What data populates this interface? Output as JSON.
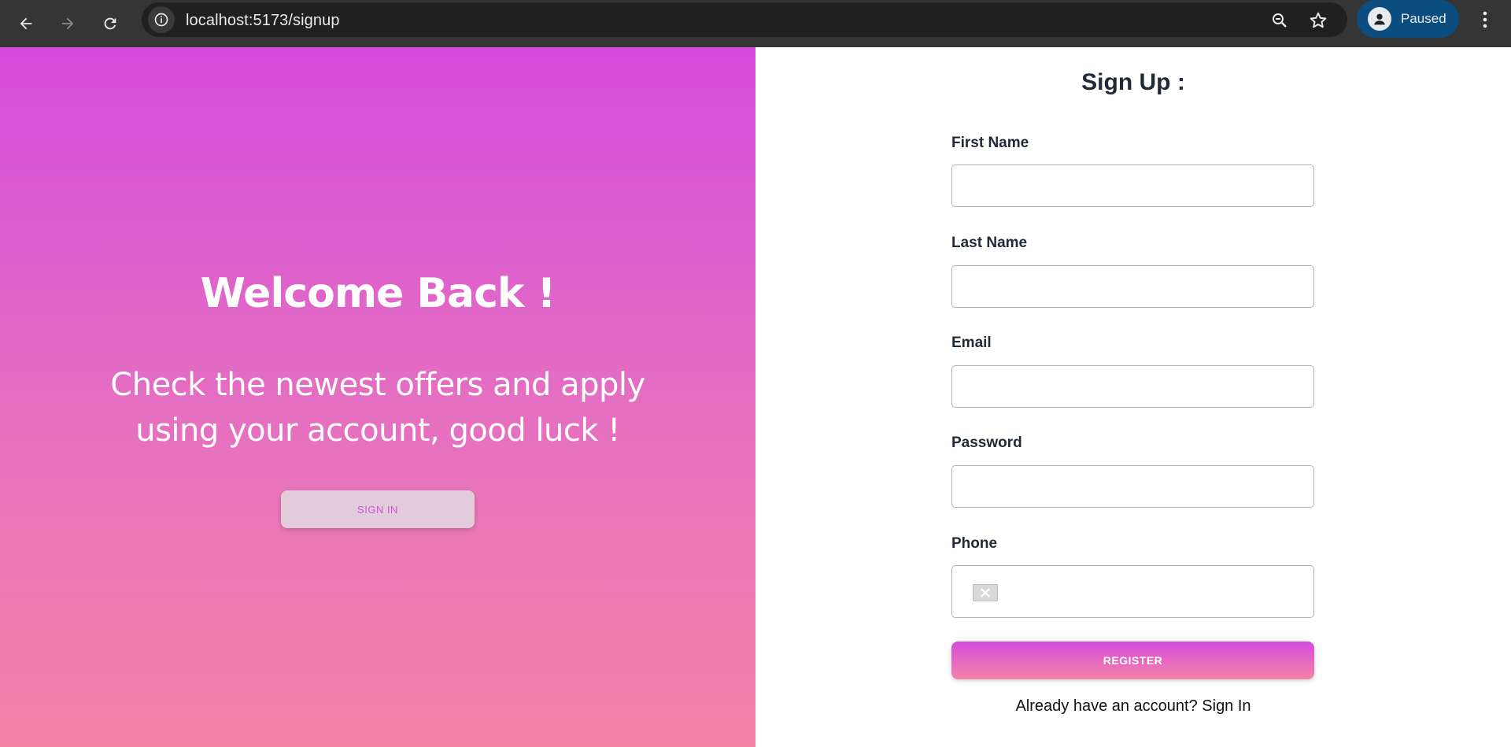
{
  "browser": {
    "url": "localhost:5173/signup",
    "profile_label": "Paused",
    "icons": {
      "back": "back-arrow-icon",
      "forward": "forward-arrow-icon",
      "reload": "reload-icon",
      "site_info": "info-icon",
      "zoom": "zoom-icon",
      "bookmark": "star-icon",
      "profile": "person-icon",
      "menu": "kebab-menu-icon"
    },
    "colors": {
      "chrome": "#353535",
      "omnibox": "#202020",
      "profile": "#0b4d7e"
    }
  },
  "left_panel": {
    "title": "Welcome Back !",
    "text_line_1": "Check the newest offers and apply",
    "text_line_2": "using your account, good luck !",
    "signin_label": "SIGN IN",
    "colors": {
      "gradient_top": "#d54bdc",
      "gradient_bottom": "#f384a7"
    }
  },
  "form": {
    "title": "Sign Up :",
    "fields": [
      {
        "label": "First Name",
        "value": ""
      },
      {
        "label": "Last Name",
        "value": ""
      },
      {
        "label": "Email",
        "value": ""
      },
      {
        "label": "Password",
        "value": ""
      },
      {
        "label": "Phone",
        "value": "",
        "flag_icon": "broken-flag-icon"
      }
    ],
    "register_label": "REGISTER",
    "have_account_text": "Already have an account? Sign In"
  }
}
